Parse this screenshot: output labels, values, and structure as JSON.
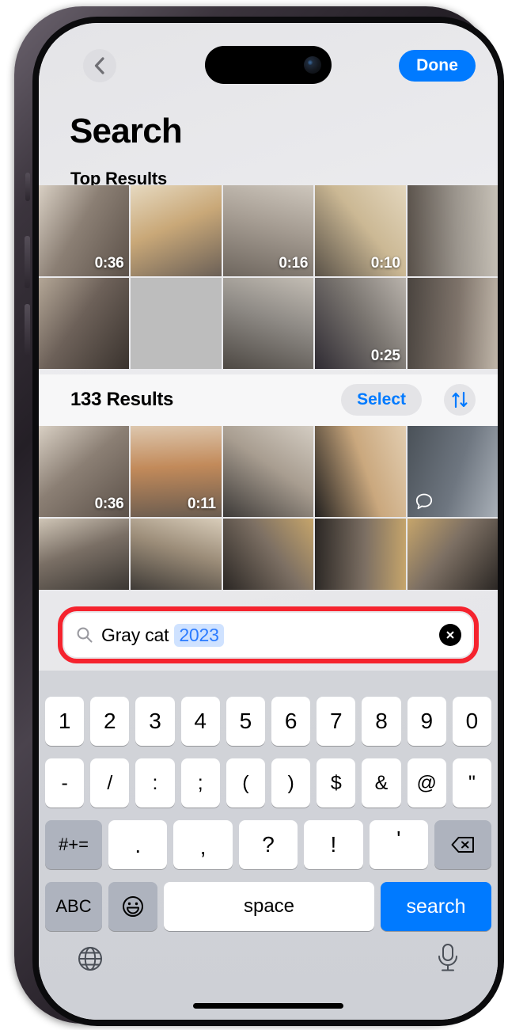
{
  "navbar": {
    "back_icon": "chevron-left-icon",
    "done_label": "Done"
  },
  "header": {
    "page_title": "Search",
    "section_title": "Top Results"
  },
  "results_bar": {
    "count_label": "133 Results",
    "select_label": "Select",
    "sort_icon": "sort-arrows-icon"
  },
  "search": {
    "search_icon": "magnifier-icon",
    "text": "Gray cat",
    "token": "2023",
    "clear_icon": "clear-circle-icon",
    "highlight_color": "#f5232e"
  },
  "top_results": [
    {
      "duration": "0:36",
      "badge": "",
      "c1": "#8b7f74",
      "c2": "#d8cfc3",
      "c3": "#5c5149"
    },
    {
      "duration": "",
      "badge": "",
      "c1": "#c9a878",
      "c2": "#e6d9c0",
      "c3": "#6b6057"
    },
    {
      "duration": "0:16",
      "badge": "",
      "c1": "#a59c92",
      "c2": "#cdc6bc",
      "c3": "#6e665e"
    },
    {
      "duration": "0:10",
      "badge": "",
      "c1": "#cbb894",
      "c2": "#e3d6bd",
      "c3": "#5a5248"
    },
    {
      "duration": "",
      "badge": "",
      "c1": "#9b958d",
      "c2": "#c7c1b7",
      "c3": "#585049"
    },
    {
      "duration": "",
      "badge": "",
      "c1": "#6d6159",
      "c2": "#b3a696",
      "c3": "#3a332e"
    },
    {
      "duration": "",
      "badge": "",
      "c1": "#b0a housings",
      "c2": "#ded3c2",
      "c3": "#4e4742"
    },
    {
      "duration": "",
      "badge": "",
      "c1": "#8e8a85",
      "c2": "#c3bdb4",
      "c3": "#4d4843"
    },
    {
      "duration": "0:25",
      "badge": "",
      "c1": "#7a7570",
      "c2": "#b9b3ac",
      "c3": "#2f2b33"
    },
    {
      "duration": "",
      "badge": "",
      "c1": "#7e736a",
      "c2": "#c0b6a9",
      "c3": "#4a443f"
    }
  ],
  "result_photos": [
    {
      "duration": "0:36",
      "badge": "",
      "c1": "#8b7f74",
      "c2": "#d8cfc3",
      "c3": "#5c5149"
    },
    {
      "duration": "0:11",
      "badge": "",
      "c1": "#c28a5a",
      "c2": "#ddc7ae",
      "c3": "#6a5c50"
    },
    {
      "duration": "",
      "badge": "",
      "c1": "#a89d90",
      "c2": "#d3ccc2",
      "c3": "#3d3a38"
    },
    {
      "duration": "",
      "badge": "",
      "c1": "#caa87e",
      "c2": "#e2cdb0",
      "c3": "#22201f"
    },
    {
      "duration": "",
      "badge": "comment-bubble-icon",
      "c1": "#6e7680",
      "c2": "#a9b0b8",
      "c3": "#4a5158"
    }
  ],
  "result_photos_row2": [
    {
      "duration": "",
      "badge": "",
      "c1": "#7a6f65",
      "c2": "#cfc5b6",
      "c3": "#3b3733"
    },
    {
      "duration": "",
      "badge": "",
      "c1": "#9b8c78",
      "c2": "#d8ccb9",
      "c3": "#3f3b37"
    },
    {
      "duration": "",
      "badge": "",
      "c1": "#7c6f63",
      "c2": "#c6a56b",
      "c3": "#2b2724"
    },
    {
      "duration": "",
      "badge": "",
      "c1": "#7c6f63",
      "c2": "#c6a56b",
      "c3": "#2b2724"
    },
    {
      "duration": "",
      "badge": "",
      "c1": "#7c6f63",
      "c2": "#c6a56b",
      "c3": "#2b2724"
    }
  ],
  "keyboard": {
    "row1": [
      "1",
      "2",
      "3",
      "4",
      "5",
      "6",
      "7",
      "8",
      "9",
      "0"
    ],
    "row2": [
      "-",
      "/",
      ":",
      ";",
      "(",
      ")",
      "$",
      "&",
      "@",
      "\""
    ],
    "row3_symbols_label": "#+=",
    "row3": [
      ".",
      ",",
      "?",
      "!",
      "'"
    ],
    "row3_backspace_icon": "backspace-icon",
    "abc_label": "ABC",
    "emoji_icon": "emoji-smiley-icon",
    "space_label": "space",
    "search_label": "search",
    "globe_icon": "globe-icon",
    "mic_icon": "microphone-icon"
  }
}
